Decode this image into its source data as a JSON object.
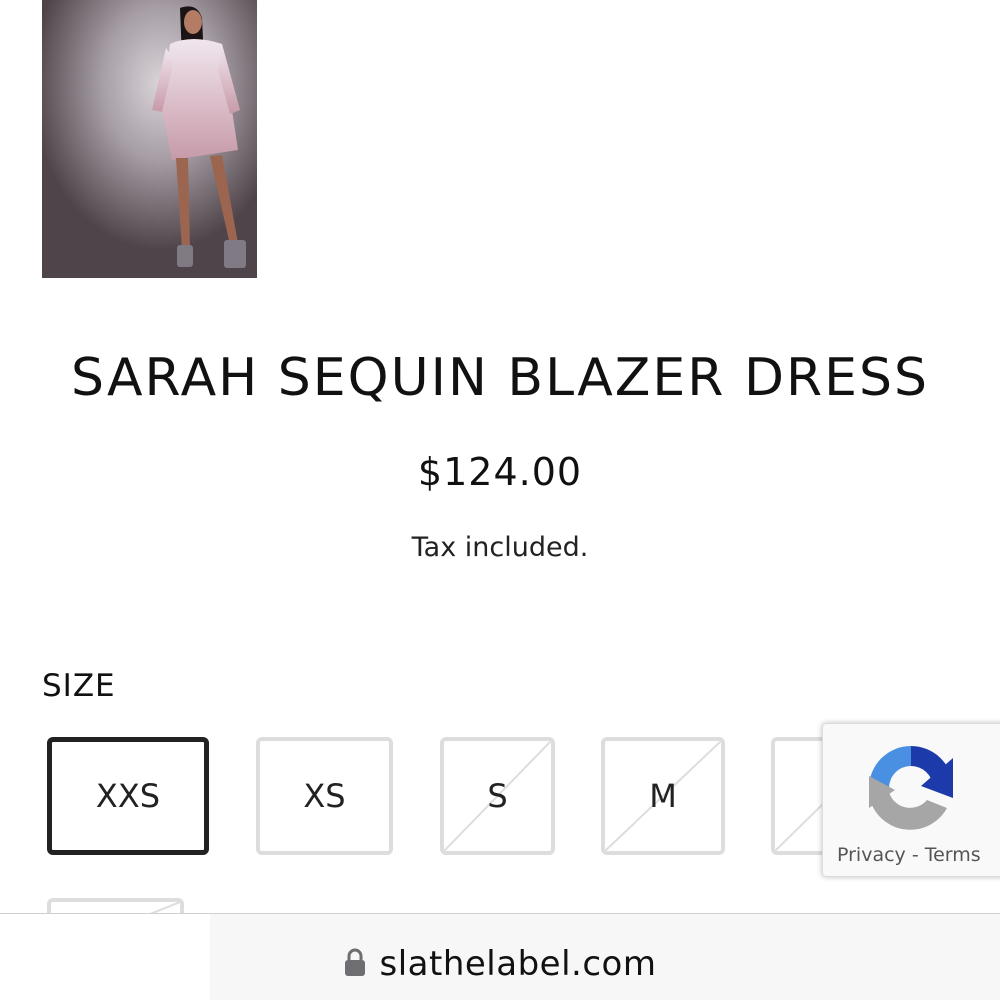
{
  "product": {
    "title": "SARAH SEQUIN BLAZER DRESS",
    "price": "$124.00",
    "tax_note": "Tax included.",
    "image_icon": "product-photo"
  },
  "size_selector": {
    "label": "SIZE",
    "options": [
      {
        "label": "XXS",
        "selected": true,
        "available": true
      },
      {
        "label": "XS",
        "selected": false,
        "available": true
      },
      {
        "label": "S",
        "selected": false,
        "available": false
      },
      {
        "label": "M",
        "selected": false,
        "available": false
      },
      {
        "label": "",
        "selected": false,
        "available": false
      },
      {
        "label": "",
        "selected": false,
        "available": false
      }
    ]
  },
  "recaptcha": {
    "links": "Privacy - Terms",
    "icon": "recaptcha-icon"
  },
  "browser": {
    "url": "slathelabel.com",
    "lock_icon": "lock-icon"
  },
  "colors": {
    "selected_border": "#222222",
    "unselected_border": "#dddddd",
    "recaptcha_blue": "#1c3aa9",
    "recaptcha_light_blue": "#4a90e2",
    "recaptcha_gray": "#a6a6a6"
  }
}
